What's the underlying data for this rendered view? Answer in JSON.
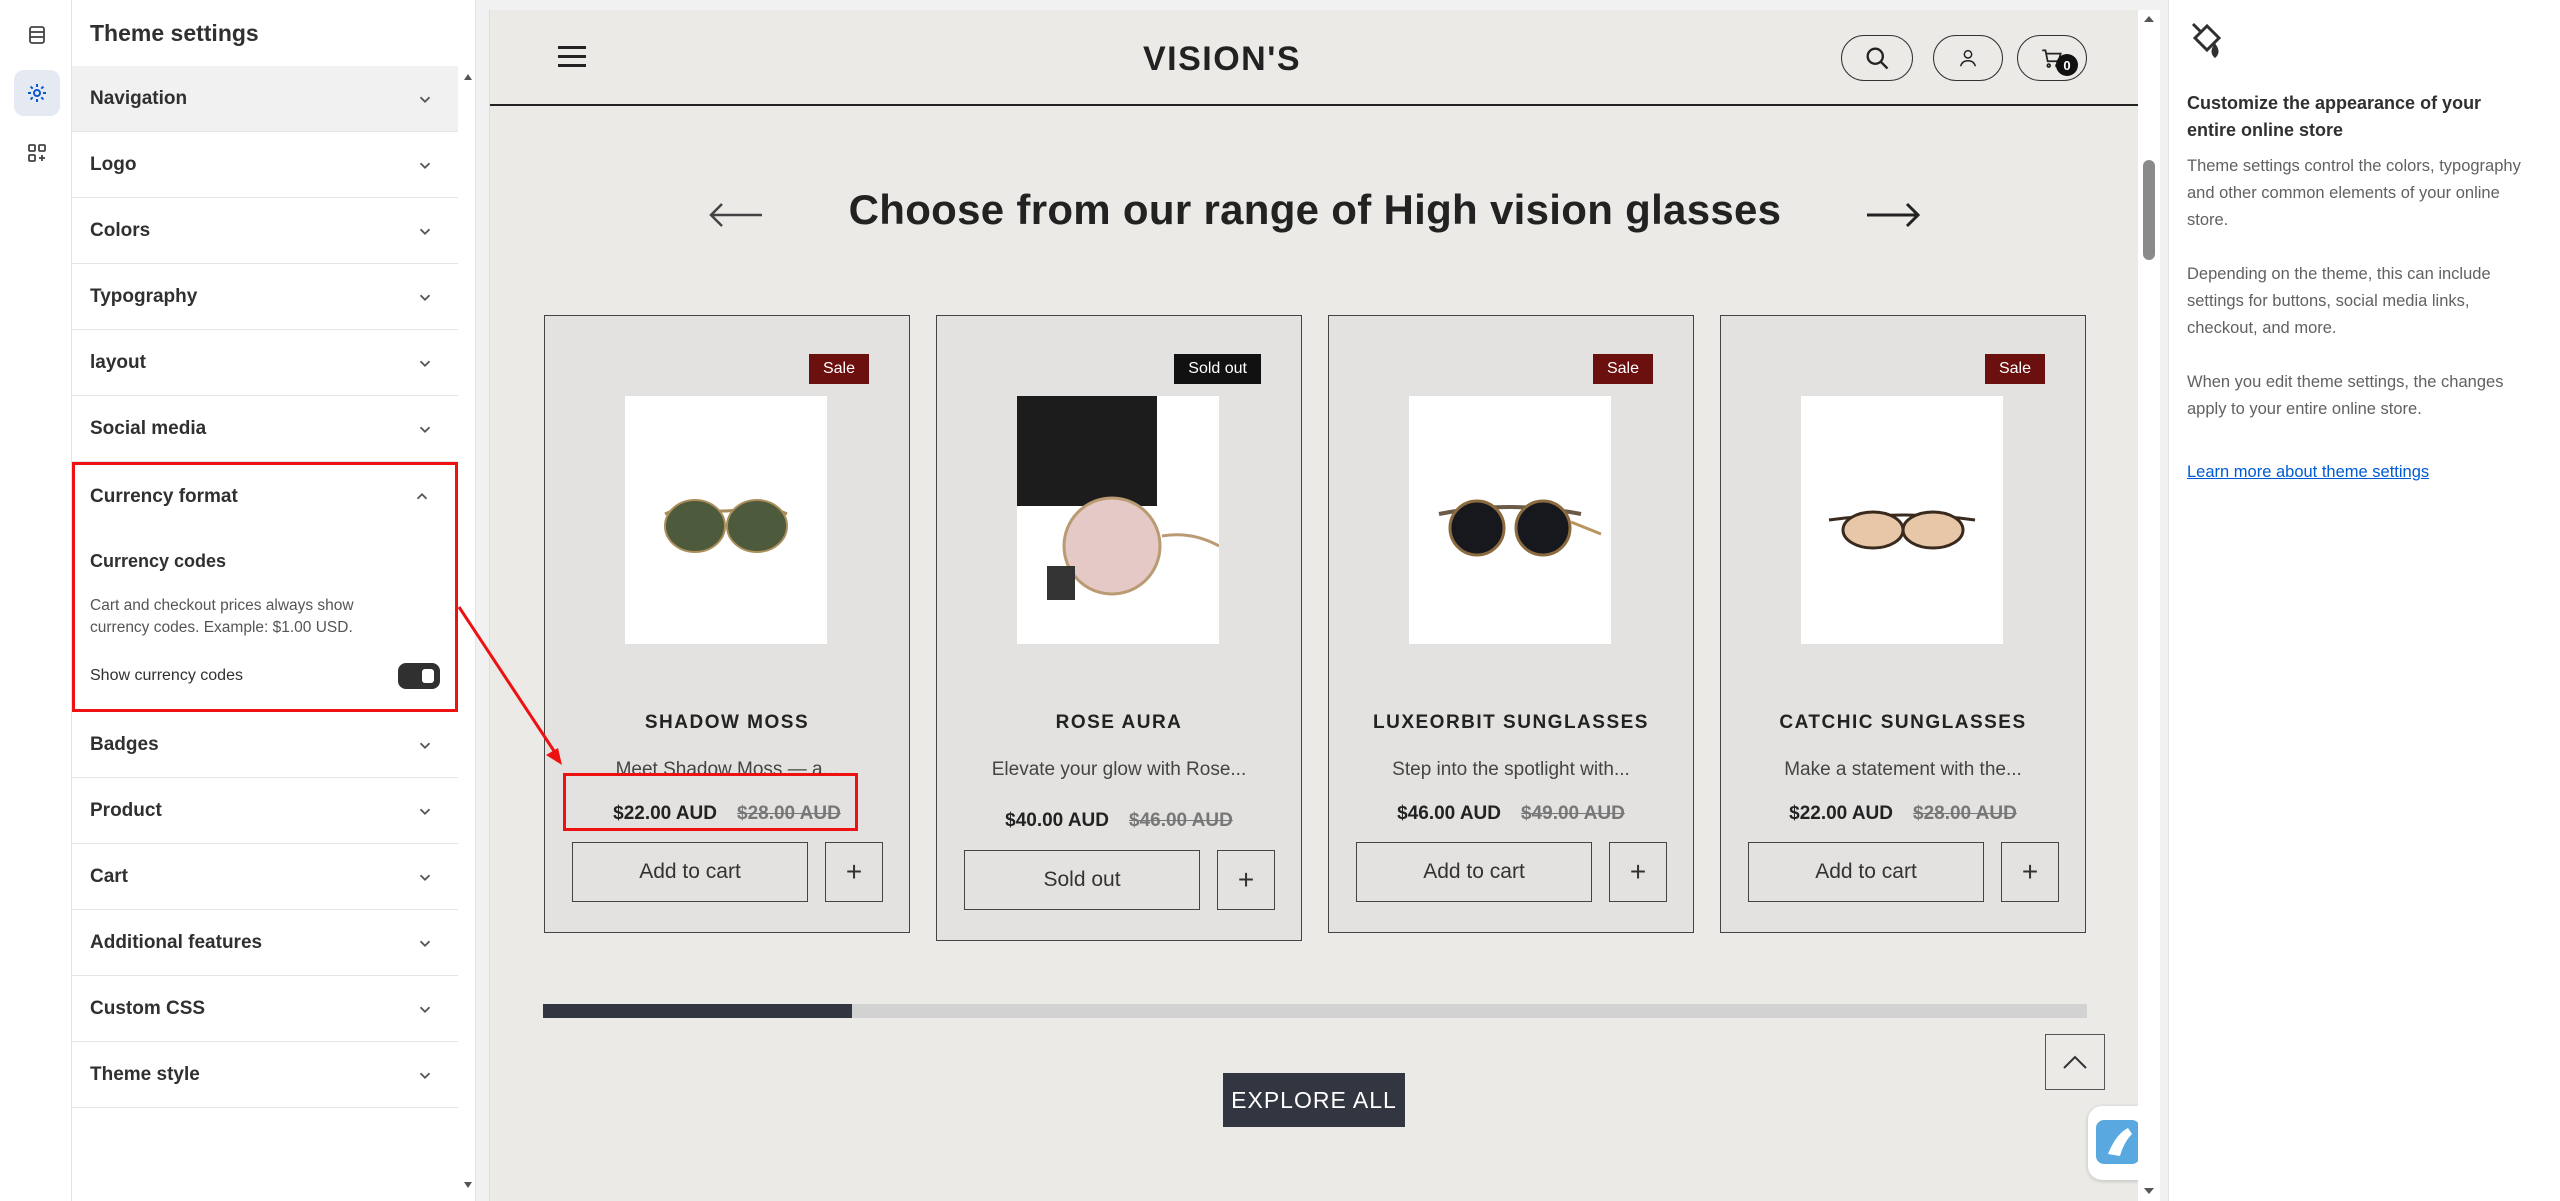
{
  "rail": {
    "items": [
      {
        "name": "sections-icon"
      },
      {
        "name": "theme-settings-gear-icon",
        "active": true
      },
      {
        "name": "apps-icon"
      }
    ]
  },
  "panel": {
    "title": "Theme settings",
    "items": [
      {
        "label": "Navigation"
      },
      {
        "label": "Logo"
      },
      {
        "label": "Colors"
      },
      {
        "label": "Typography"
      },
      {
        "label": "layout"
      },
      {
        "label": "Social media"
      }
    ],
    "open_section": {
      "label": "Currency format",
      "sub_title": "Currency codes",
      "description": "Cart and checkout prices always show currency codes. Example: $1.00 USD.",
      "toggle_label": "Show currency codes",
      "toggle_on": true
    },
    "items_after": [
      {
        "label": "Badges"
      },
      {
        "label": "Product"
      },
      {
        "label": "Cart"
      },
      {
        "label": "Additional features"
      },
      {
        "label": "Custom CSS"
      },
      {
        "label": "Theme style"
      }
    ]
  },
  "store": {
    "logo": "VISION'S",
    "cart_count": "0",
    "section_title": "Choose from our range of High vision glasses",
    "products": [
      {
        "badge": "Sale",
        "badge_type": "sale",
        "name": "SHADOW MOSS",
        "desc": "Meet Shadow Moss — a...",
        "price": "$22.00 AUD",
        "compare": "$28.00 AUD",
        "button": "Add to cart",
        "image": "aviator-sunglasses"
      },
      {
        "badge": "Sold out",
        "badge_type": "soldout",
        "name": "ROSE AURA",
        "desc": "Elevate your glow with Rose...",
        "price": "$40.00 AUD",
        "compare": "$46.00 AUD",
        "button": "Sold out",
        "image": "rose-round-glasses"
      },
      {
        "badge": "Sale",
        "badge_type": "sale",
        "name": "LUXEORBIT SUNGLASSES",
        "desc": "Step into the spotlight with...",
        "price": "$46.00 AUD",
        "compare": "$49.00 AUD",
        "button": "Add to cart",
        "image": "round-clip-sunglasses"
      },
      {
        "badge": "Sale",
        "badge_type": "sale",
        "name": "CATCHIC SUNGLASSES",
        "desc": "Make a statement with the...",
        "price": "$22.00 AUD",
        "compare": "$28.00 AUD",
        "button": "Add to cart",
        "image": "oval-tinted-sunglasses"
      }
    ],
    "plus": "+",
    "carousel_progress": 0.2,
    "explore_label": "EXPLORE ALL"
  },
  "info": {
    "heading": "Customize the appearance of your entire online store",
    "p1": "Theme settings control the colors, typography and other common elements of your online store.",
    "p2": "Depending on the theme, this can include settings for buttons, social media links, checkout, and more.",
    "p3": "When you edit theme settings, the changes apply to your entire online store.",
    "link": "Learn more about theme settings"
  },
  "colors": {
    "highlight": "#ee1111",
    "sale_badge": "#6b0f0f",
    "soldout_badge": "#111111",
    "button_dark": "#323640",
    "link": "#005bd3"
  }
}
